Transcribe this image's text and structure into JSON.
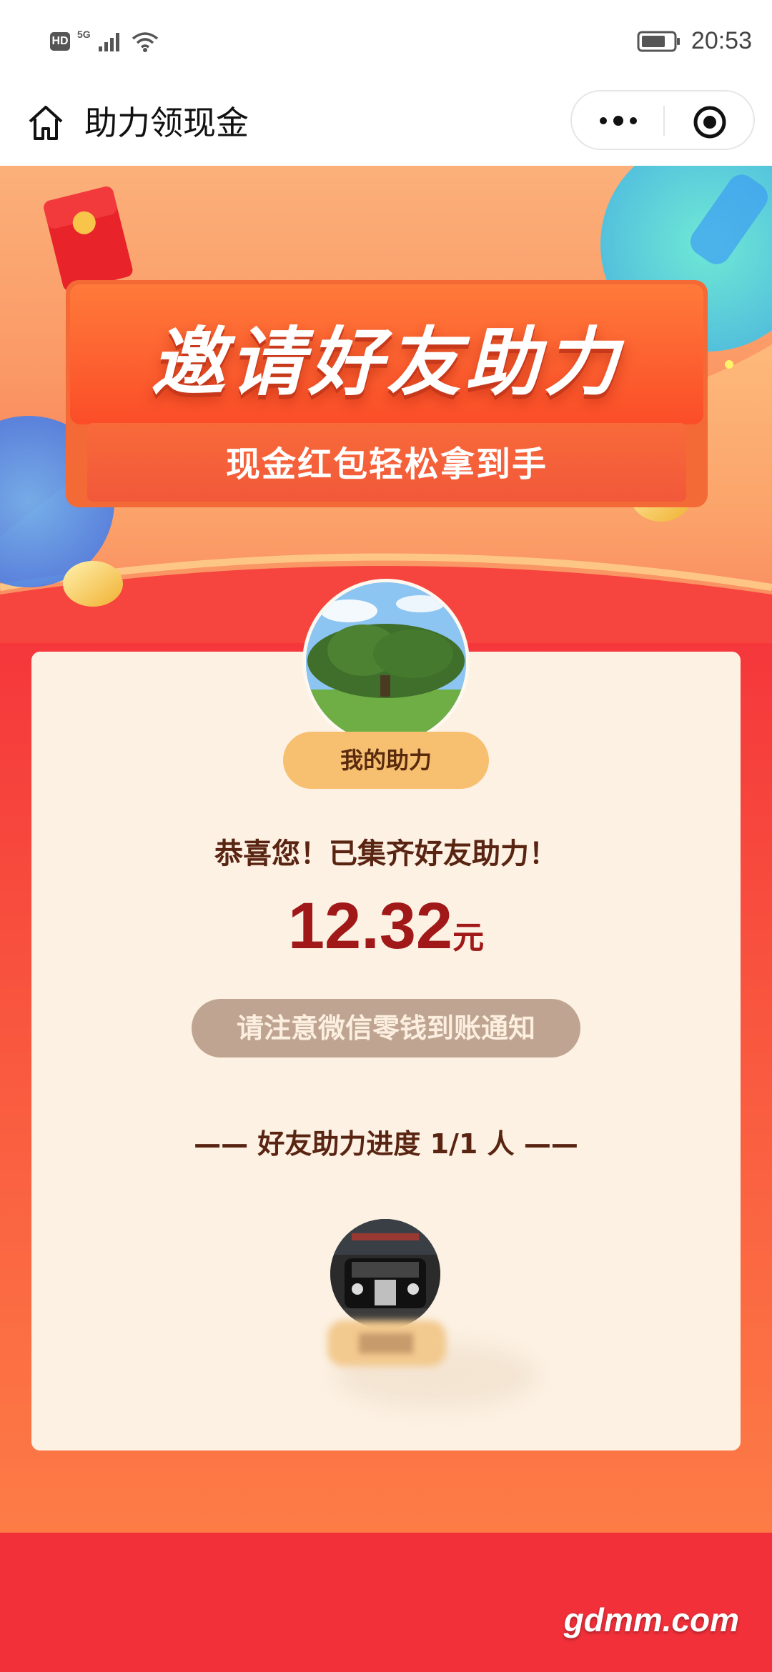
{
  "status_bar": {
    "network_badge": "HD",
    "network_type": "5G",
    "time": "20:53"
  },
  "nav": {
    "title": "助力领现金",
    "home_icon": "home-icon",
    "more_icon": "more-dots-icon",
    "close_icon": "target-close-icon"
  },
  "banner": {
    "title": "邀请好友助力",
    "subtitle": "现金红包轻松拿到手"
  },
  "card": {
    "my_help_label": "我的助力",
    "congrats_text": "恭喜您！已集齐好友助力！",
    "amount": "12.32",
    "amount_unit": "元",
    "notice": "请注意微信零钱到账通知",
    "progress_text": "—— 好友助力进度 1/1 人 ——"
  },
  "watermark": "gdmm.com",
  "colors": {
    "accent_red": "#a01818",
    "card_bg": "#fcf1e3",
    "pill_gold": "#f7c070",
    "notice_pill": "#bea491",
    "page_red": "#f5373b"
  }
}
